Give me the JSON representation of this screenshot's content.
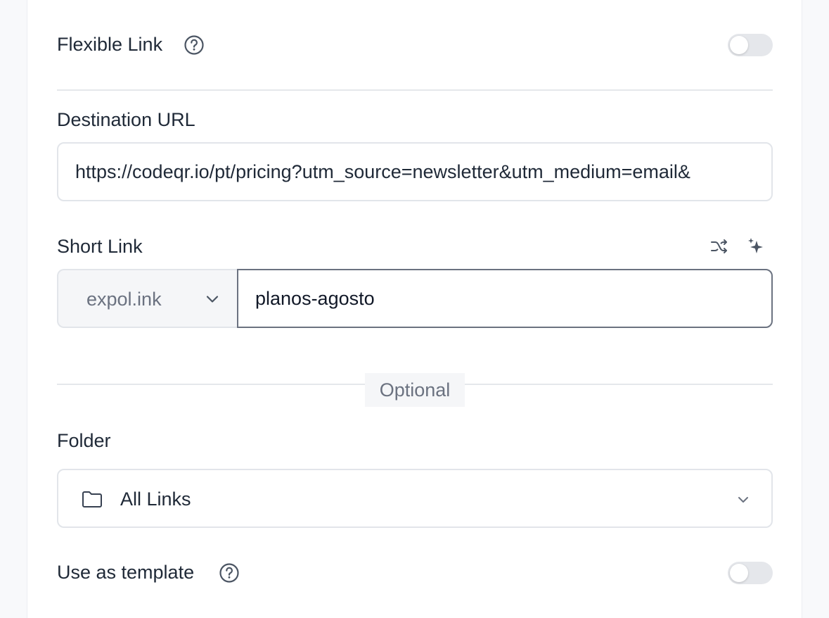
{
  "flexible_link": {
    "label": "Flexible Link",
    "help_icon": "question-circle-icon",
    "toggle_on": false
  },
  "destination": {
    "label": "Destination URL",
    "value": "https://codeqr.io/pt/pricing?utm_source=newsletter&utm_medium=email&"
  },
  "short_link": {
    "label": "Short Link",
    "domain": "expol.ink",
    "slug": "planos-agosto",
    "shuffle_icon": "shuffle-icon",
    "ai_icon": "sparkles-icon"
  },
  "optional_label": "Optional",
  "folder": {
    "label": "Folder",
    "value": "All Links",
    "icon": "folder-icon"
  },
  "template": {
    "label": "Use as template",
    "help_icon": "question-circle-icon",
    "toggle_on": false
  },
  "colors": {
    "text": "#1f2937",
    "muted": "#6b7280",
    "border": "#e2e5ea",
    "toggle_off": "#e5e7eb"
  }
}
